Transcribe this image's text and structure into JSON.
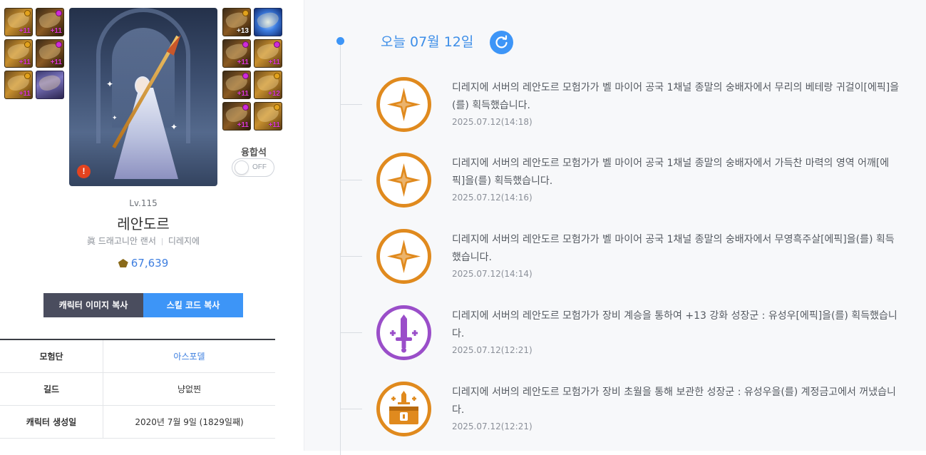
{
  "equipment_left": [
    {
      "enh": "+11",
      "enh_color": "pink",
      "gem": "gold"
    },
    {
      "enh": "+11",
      "enh_color": "pink",
      "gem": "pink"
    },
    {
      "enh": "+11",
      "enh_color": "pink",
      "gem": "gold"
    },
    {
      "enh": "+11",
      "enh_color": "pink",
      "gem": "pink"
    },
    {
      "enh": "+11",
      "enh_color": "pink",
      "gem": "gold"
    },
    {
      "enh": "",
      "enh_color": "",
      "gem": ""
    }
  ],
  "equipment_right": [
    {
      "enh": "+13",
      "enh_color": "white",
      "gem": "gold"
    },
    {
      "enh": "",
      "enh_color": "",
      "gem": ""
    },
    {
      "enh": "+11",
      "enh_color": "pink",
      "gem": "pink"
    },
    {
      "enh": "+11",
      "enh_color": "pink",
      "gem": "pink"
    },
    {
      "enh": "+11",
      "enh_color": "pink",
      "gem": "pink"
    },
    {
      "enh": "+12",
      "enh_color": "pink",
      "gem": "gold"
    },
    {
      "enh": "+11",
      "enh_color": "pink",
      "gem": "pink"
    },
    {
      "enh": "+11",
      "enh_color": "pink",
      "gem": "gold"
    }
  ],
  "character": {
    "level": "Lv.115",
    "name": "레안도르",
    "class": "眞 드래고니안 랜서",
    "server": "디레지에",
    "power": "67,639",
    "fusion_label": "융합석",
    "fusion_toggle": "OFF",
    "alert": "!"
  },
  "buttons": {
    "copy_image": "캐릭터 이미지 복사",
    "copy_skill": "스킬 코드 복사"
  },
  "info": [
    {
      "key": "모험단",
      "value": "아스포델"
    },
    {
      "key": "길드",
      "value": "냥없찐"
    },
    {
      "key": "캐릭터 생성일",
      "value": "2020년 7월 9일 (1829일째)"
    }
  ],
  "timeline": {
    "date_title": "오늘 07월 12일",
    "entries": [
      {
        "text": "디레지에 서버의 레안도르 모험가가 벨 마이어 공국 1채널 종말의 숭배자에서 무리의 베테랑 귀걸이[에픽]을(를) 획득했습니다.",
        "time": "2025.07.12(14:18)",
        "icon": "epic-star-icon",
        "color": "#e08a1e"
      },
      {
        "text": "디레지에 서버의 레안도르 모험가가 벨 마이어 공국 1채널 종말의 숭배자에서 가득찬 마력의 영역 어깨[에픽]을(를) 획득했습니다.",
        "time": "2025.07.12(14:16)",
        "icon": "epic-star-icon",
        "color": "#e08a1e"
      },
      {
        "text": "디레지에 서버의 레안도르 모험가가 벨 마이어 공국 1채널 종말의 숭배자에서 무영흑주살[에픽]을(를) 획득했습니다.",
        "time": "2025.07.12(14:14)",
        "icon": "epic-star-icon",
        "color": "#e08a1e"
      },
      {
        "text": "디레지에 서버의 레안도르 모험가가 장비 계승을 통하여 +13 강화 성장군 : 유성우[에픽]을(를) 획득했습니다.",
        "time": "2025.07.12(12:21)",
        "icon": "sword-upgrade-icon",
        "color": "#9a4ec9"
      },
      {
        "text": "디레지에 서버의 레안도르 모험가가 장비 초월을 통해 보관한 성장군 : 유성우을(를) 계정금고에서 꺼냈습니다.",
        "time": "2025.07.12(12:21)",
        "icon": "vault-chest-icon",
        "color": "#e08a1e"
      }
    ]
  }
}
